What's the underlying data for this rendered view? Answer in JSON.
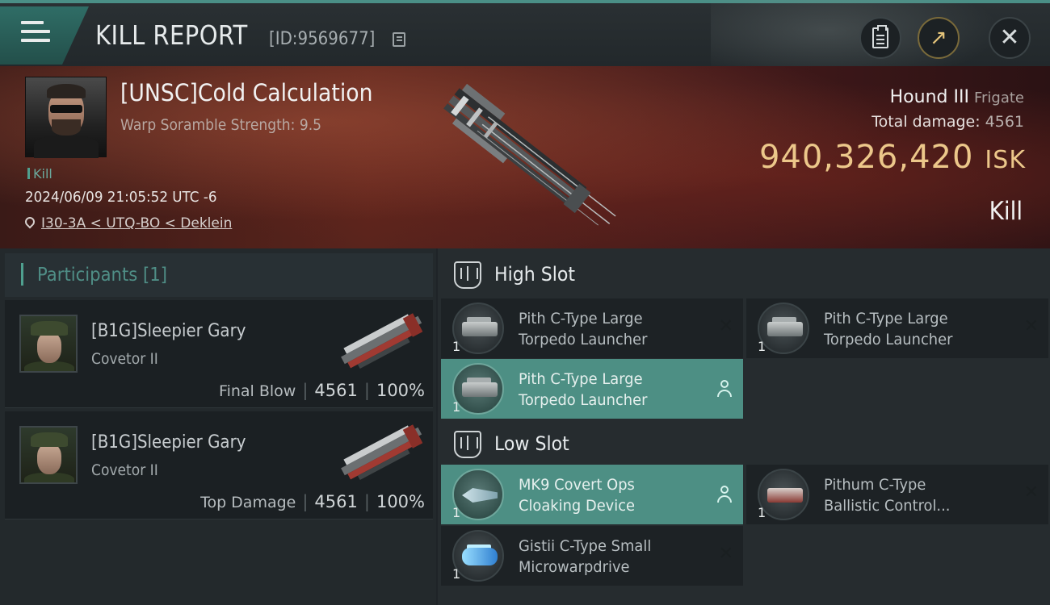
{
  "header": {
    "title": "KILL REPORT",
    "report_id": "[ID:9569677]",
    "menu_icon": "hamburger-menu-icon",
    "actions": [
      "clipboard-icon",
      "share-icon",
      "close-icon"
    ]
  },
  "victim": {
    "name": "[UNSC]Cold Calculation",
    "warp_scramble": "Warp Soramble Strength: 9.5",
    "tag": "Kill",
    "datetime": "2024/06/09 21:05:52 UTC -6",
    "location": "I30-3A < UTQ-BO < Deklein",
    "ship_name": "Hound III",
    "ship_class": "Frigate",
    "total_damage_label": "Total damage:",
    "total_damage": "4561",
    "isk_value": "940,326,420",
    "isk_unit": "ISK",
    "result": "Kill"
  },
  "participants": {
    "header": "Participants [1]",
    "rows": [
      {
        "name": "[B1G]Sleepier Gary",
        "ship": "Covetor II",
        "role": "Final Blow",
        "damage": "4561",
        "percent": "100%"
      },
      {
        "name": "[B1G]Sleepier Gary",
        "ship": "Covetor II",
        "role": "Top Damage",
        "damage": "4561",
        "percent": "100%"
      }
    ]
  },
  "slots": {
    "high": {
      "title": "High Slot",
      "modules": [
        {
          "name_line1": "Pith C-Type Large",
          "name_line2": "Torpedo Launcher",
          "qty": "1",
          "state": "destroyed"
        },
        {
          "name_line1": "Pith C-Type Large",
          "name_line2": "Torpedo Launcher",
          "qty": "1",
          "state": "destroyed"
        },
        {
          "name_line1": "Pith C-Type Large",
          "name_line2": "Torpedo Launcher",
          "qty": "1",
          "state": "dropped"
        }
      ]
    },
    "low": {
      "title": "Low Slot",
      "modules": [
        {
          "name_line1": "MK9 Covert Ops",
          "name_line2": "Cloaking Device",
          "qty": "1",
          "state": "dropped"
        },
        {
          "name_line1": "Pithum C-Type",
          "name_line2": "Ballistic Control...",
          "qty": "1",
          "state": "destroyed"
        },
        {
          "name_line1": "Gistii C-Type Small",
          "name_line2": "Microwarpdrive",
          "qty": "1",
          "state": "destroyed"
        }
      ]
    }
  },
  "colors": {
    "accent": "#4fa08f",
    "selected_slot": "#4d8f84",
    "isk_gold": "#ecc78a",
    "banner_red": "#5a241c"
  }
}
